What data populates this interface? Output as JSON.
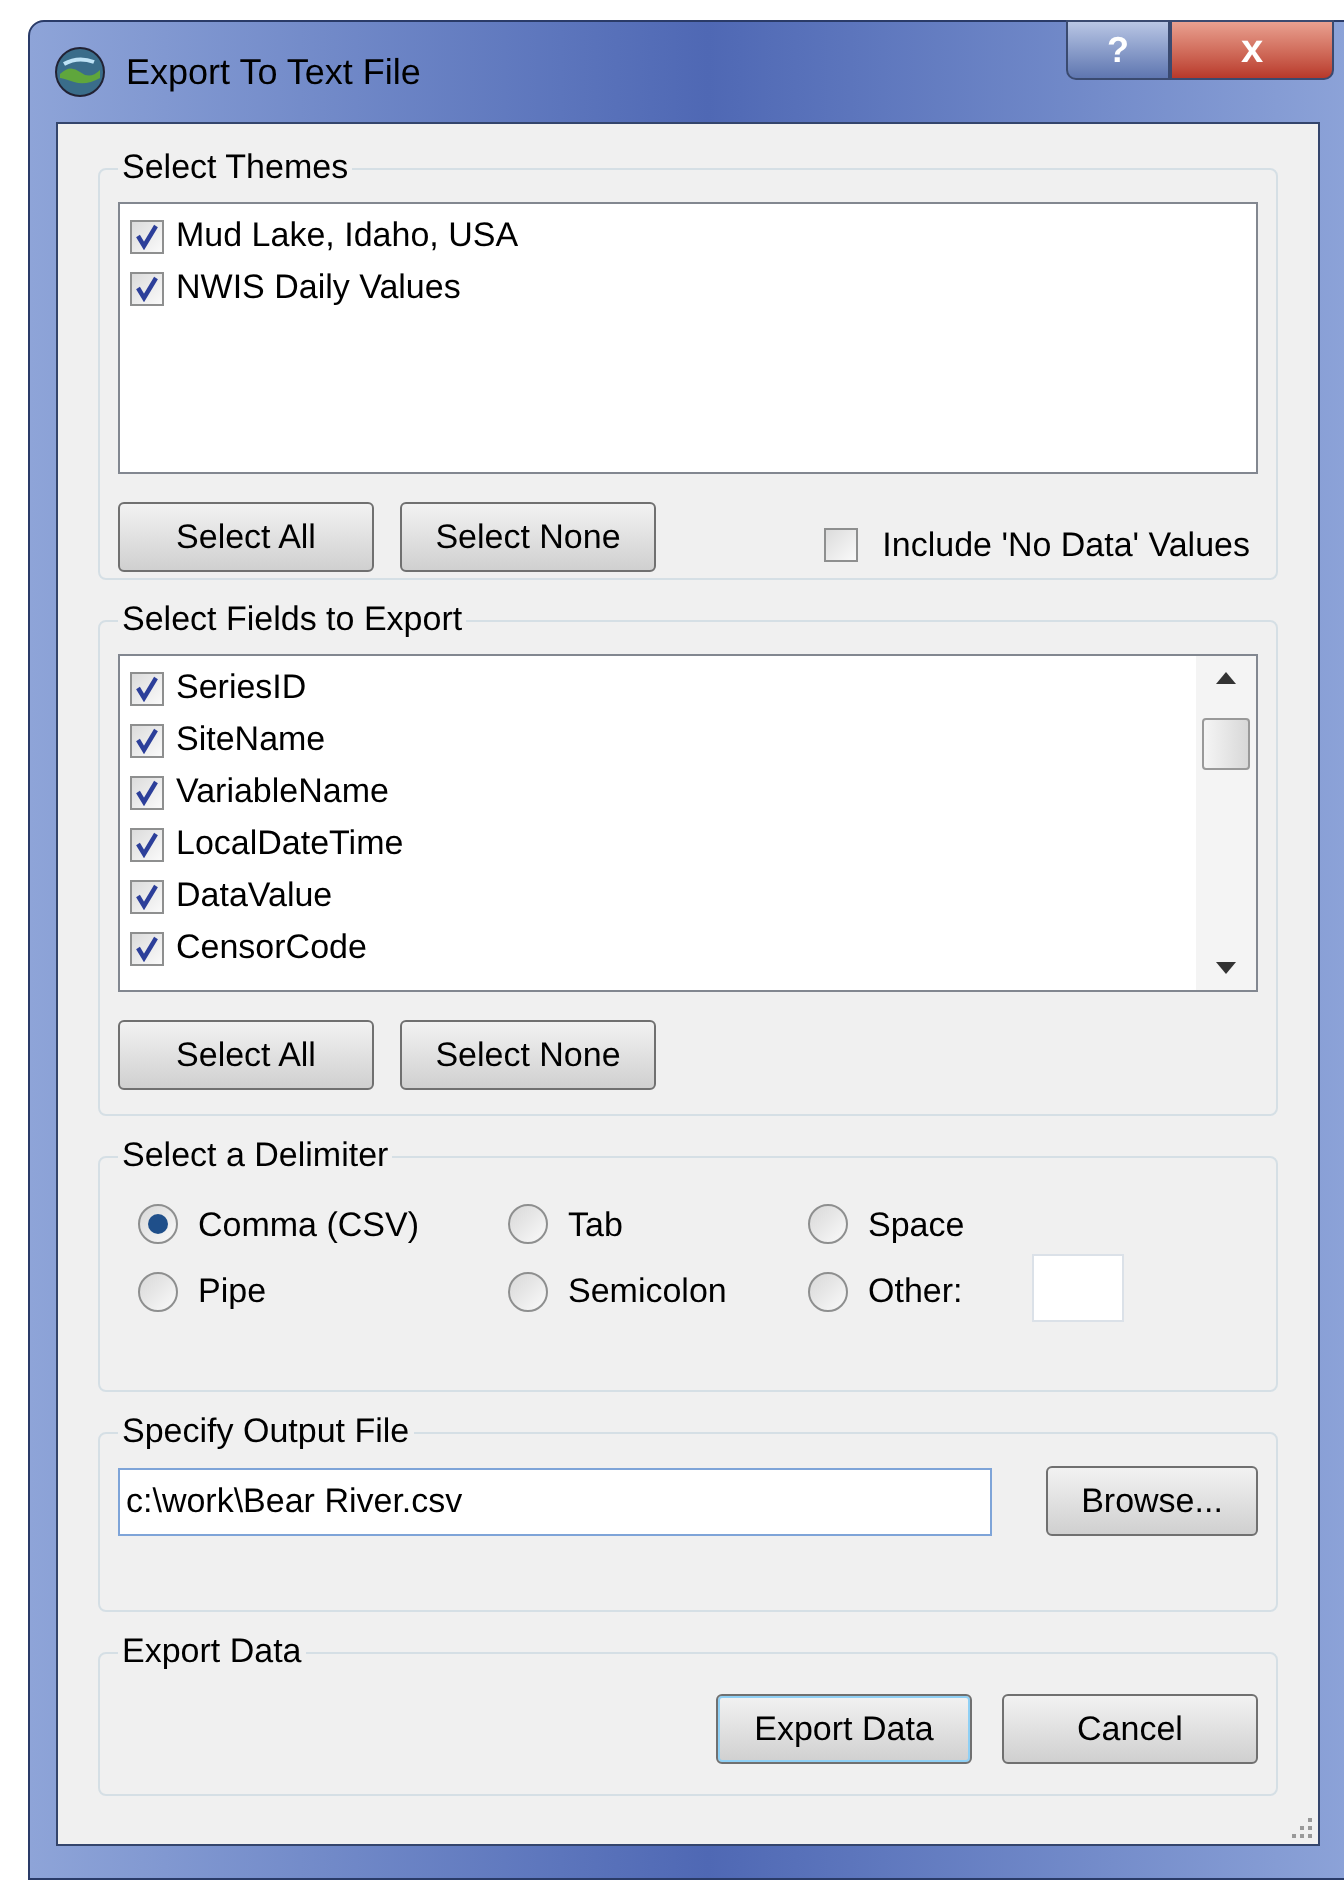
{
  "window": {
    "title": "Export To Text File",
    "buttons": [
      "?",
      "x"
    ]
  },
  "themes": {
    "title": "Select Themes",
    "items": [
      {
        "label": "Mud Lake, Idaho, USA",
        "checked": true
      },
      {
        "label": "NWIS Daily Values",
        "checked": true
      }
    ],
    "buttons": [
      "Select All",
      "Select None"
    ],
    "include_no_data": {
      "label": "Include 'No Data' Values",
      "checked": false
    }
  },
  "fields": {
    "title": "Select Fields to Export",
    "items": [
      {
        "label": "SeriesID",
        "checked": true
      },
      {
        "label": "SiteName",
        "checked": true
      },
      {
        "label": "VariableName",
        "checked": true
      },
      {
        "label": "LocalDateTime",
        "checked": true
      },
      {
        "label": "DataValue",
        "checked": true
      },
      {
        "label": "CensorCode",
        "checked": true
      }
    ],
    "buttons": [
      "Select All",
      "Select None"
    ]
  },
  "delimiter": {
    "title": "Select a Delimiter",
    "options": [
      {
        "label": "Comma (CSV)",
        "selected": true
      },
      {
        "label": "Tab",
        "selected": false
      },
      {
        "label": "Space",
        "selected": false
      },
      {
        "label": "Pipe",
        "selected": false
      },
      {
        "label": "Semicolon",
        "selected": false
      },
      {
        "label": "Other:",
        "selected": false
      }
    ]
  },
  "output": {
    "title": "Specify Output File",
    "value": "c:\\work\\Bear River.csv",
    "button": "Browse..."
  },
  "export": {
    "title": "Export Data",
    "buttons": [
      "Export Data",
      "Cancel"
    ]
  }
}
